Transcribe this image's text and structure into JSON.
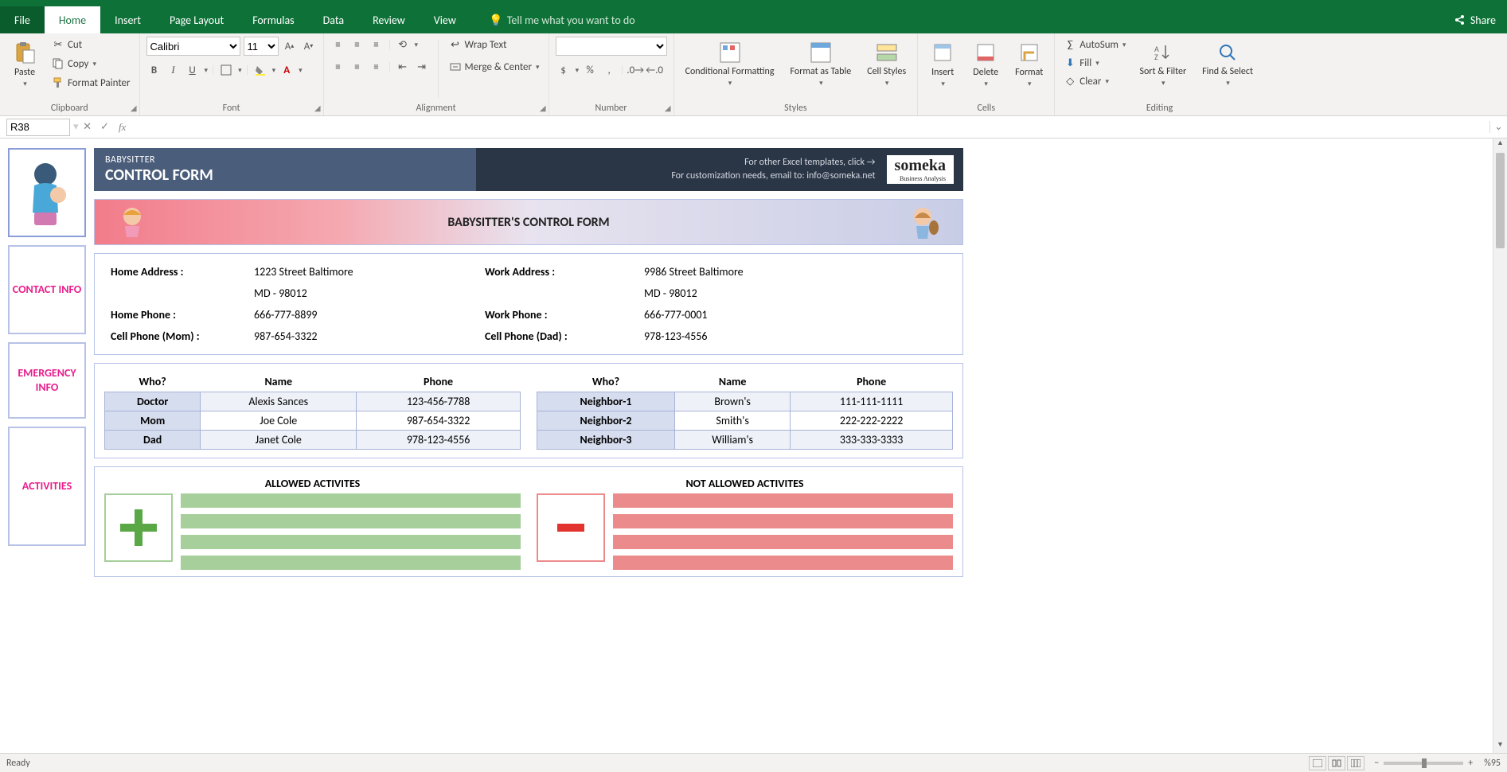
{
  "ribbon": {
    "tabs": [
      "File",
      "Home",
      "Insert",
      "Page Layout",
      "Formulas",
      "Data",
      "Review",
      "View"
    ],
    "active": "Home",
    "tell": "Tell me what you want to do",
    "share": "Share",
    "clipboard": {
      "paste": "Paste",
      "cut": "Cut",
      "copy": "Copy",
      "painter": "Format Painter",
      "label": "Clipboard"
    },
    "font": {
      "name": "Calibri",
      "size": "11",
      "label": "Font"
    },
    "alignment": {
      "wrap": "Wrap Text",
      "merge": "Merge & Center",
      "label": "Alignment"
    },
    "number": {
      "label": "Number"
    },
    "styles": {
      "cond": "Conditional Formatting",
      "table": "Format as Table",
      "cell": "Cell Styles",
      "label": "Styles"
    },
    "cells": {
      "insert": "Insert",
      "delete": "Delete",
      "format": "Format",
      "label": "Cells"
    },
    "editing": {
      "autosum": "AutoSum",
      "fill": "Fill",
      "clear": "Clear",
      "sort": "Sort & Filter",
      "find": "Find & Select",
      "label": "Editing"
    }
  },
  "formula": {
    "cell": "R38",
    "value": ""
  },
  "header": {
    "small": "BABYSITTER",
    "big": "CONTROL FORM",
    "templates": "For other Excel templates, click →",
    "custom": "For customization needs, email to: info@someka.net",
    "brand": "someka",
    "brand_sub": "Business Analysis"
  },
  "banner_title": "BABYSITTER'S CONTROL FORM",
  "sections": {
    "contact": "CONTACT INFO",
    "emergency": "EMERGENCY INFO",
    "activities": "ACTIVITIES"
  },
  "contact": {
    "home_address_lbl": "Home Address :",
    "home_address": "1223 Street Baltimore",
    "home_address2": "MD - 98012",
    "work_address_lbl": "Work Address :",
    "work_address": "9986 Street Baltimore",
    "work_address2": "MD - 98012",
    "home_phone_lbl": "Home Phone :",
    "home_phone": "666-777-8899",
    "work_phone_lbl": "Work Phone :",
    "work_phone": "666-777-0001",
    "cell_mom_lbl": "Cell Phone (Mom) :",
    "cell_mom": "987-654-3322",
    "cell_dad_lbl": "Cell Phone (Dad) :",
    "cell_dad": "978-123-4556"
  },
  "emergency": {
    "headers": {
      "who": "Who?",
      "name": "Name",
      "phone": "Phone"
    },
    "left": [
      {
        "who": "Doctor",
        "name": "Alexis Sances",
        "phone": "123-456-7788"
      },
      {
        "who": "Mom",
        "name": "Joe Cole",
        "phone": "987-654-3322"
      },
      {
        "who": "Dad",
        "name": "Janet Cole",
        "phone": "978-123-4556"
      }
    ],
    "right": [
      {
        "who": "Neighbor-1",
        "name": "Brown's",
        "phone": "111-111-1111"
      },
      {
        "who": "Neighbor-2",
        "name": "Smith's",
        "phone": "222-222-2222"
      },
      {
        "who": "Neighbor-3",
        "name": "William's",
        "phone": "333-333-3333"
      }
    ]
  },
  "activities": {
    "allowed": "ALLOWED ACTIVITES",
    "notallowed": "NOT ALLOWED ACTIVITES"
  },
  "status": {
    "ready": "Ready",
    "zoom": "%95"
  }
}
